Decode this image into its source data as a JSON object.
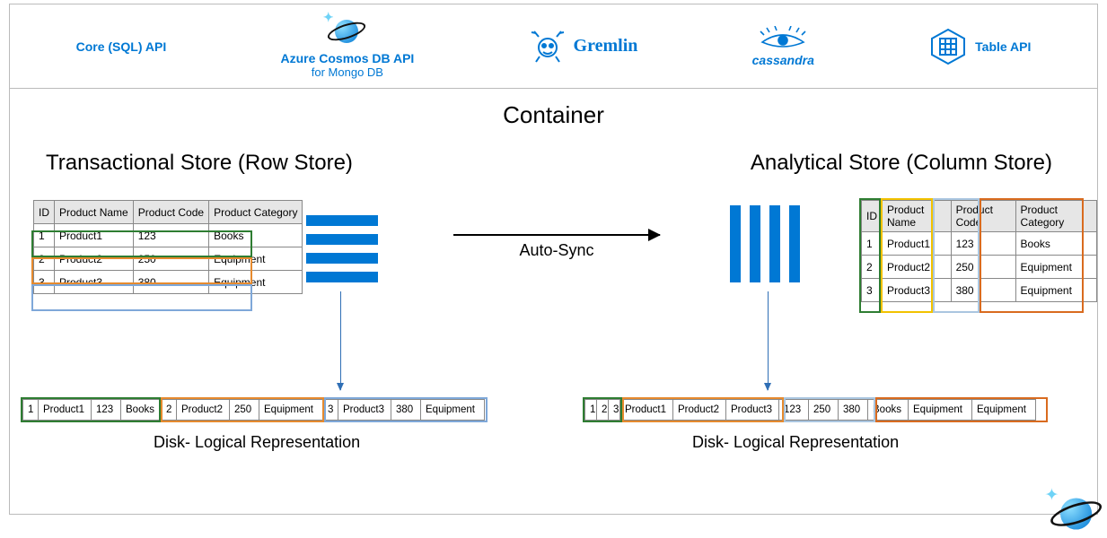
{
  "apis": {
    "core": "Core (SQL) API",
    "mongo_line1": "Azure Cosmos DB API",
    "mongo_line2": "for Mongo DB",
    "gremlin": "Gremlin",
    "cassandra": "cassandra",
    "table": "Table API"
  },
  "container_title": "Container",
  "left_section": "Transactional Store (Row Store)",
  "right_section": "Analytical Store (Column Store)",
  "auto_sync": "Auto-Sync",
  "disk_caption": "Disk- Logical Representation",
  "table": {
    "headers": {
      "id": "ID",
      "name": "Product Name",
      "code": "Product Code",
      "cat": "Product Category"
    },
    "rows": [
      {
        "id": "1",
        "name": "Product1",
        "code": "123",
        "cat": "Books"
      },
      {
        "id": "2",
        "name": "Product2",
        "code": "250",
        "cat": "Equipment"
      },
      {
        "id": "3",
        "name": "Product3",
        "code": "380",
        "cat": "Equipment"
      }
    ]
  },
  "colors": {
    "green": "#2e7d32",
    "orange": "#e68a2e",
    "blue": "#7fa8d9",
    "yellow": "#f2c200",
    "lightblue": "#aac6e0",
    "darkorange": "#d96b1f"
  },
  "disk_left_cells": [
    "1",
    "Product1",
    "123",
    "Books",
    "2",
    "Product2",
    "250",
    "Equipment",
    "3",
    "Product3",
    "380",
    "Equipment"
  ],
  "disk_right_cells": [
    "1",
    "2",
    "3",
    "Product1",
    "Product2",
    "Product3",
    "123",
    "250",
    "380",
    "Books",
    "Equipment",
    "Equipment"
  ]
}
